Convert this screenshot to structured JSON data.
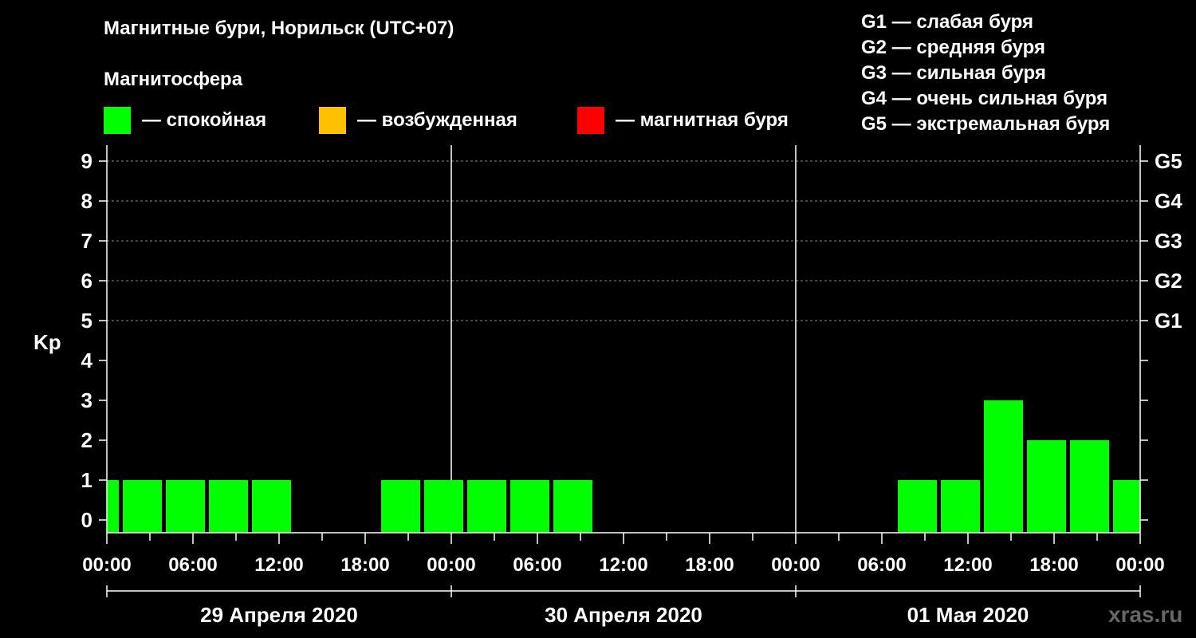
{
  "title": "Магнитные бури, Норильск (UTC+07)",
  "magnetosphere_label": "Магнитосфера",
  "legend": [
    {
      "label": "— спокойная",
      "color": "#00ff00"
    },
    {
      "label": "— возбужденная",
      "color": "#ffc000"
    },
    {
      "label": "— магнитная буря",
      "color": "#ff0000"
    }
  ],
  "g_legend": [
    "G1 — слабая буря",
    "G2 — средняя буря",
    "G3 — сильная буря",
    "G4 — очень сильная буря",
    "G5 — экстремальная буря"
  ],
  "brand": "xras.ru",
  "chart_data": {
    "type": "bar",
    "ylabel": "Kp",
    "ylim": [
      0,
      9
    ],
    "y_ticks": [
      "0",
      "1",
      "2",
      "3",
      "4",
      "5",
      "6",
      "7",
      "8",
      "9"
    ],
    "right_ticks": [
      {
        "kp": 5,
        "label": "G1"
      },
      {
        "kp": 6,
        "label": "G2"
      },
      {
        "kp": 7,
        "label": "G3"
      },
      {
        "kp": 8,
        "label": "G4"
      },
      {
        "kp": 9,
        "label": "G5"
      }
    ],
    "x_tick_labels": [
      "00:00",
      "06:00",
      "12:00",
      "18:00",
      "00:00",
      "06:00",
      "12:00",
      "18:00",
      "00:00",
      "06:00",
      "12:00",
      "18:00",
      "00:00"
    ],
    "days": [
      "29 Апреля 2020",
      "30 Апреля 2020",
      "01 Мая 2020"
    ],
    "grid": "dashed at Kp 5-9",
    "bars": [
      {
        "start": "29 Апреля 2020 00:00",
        "end": "29 Апреля 2020 01:00",
        "kp": 1,
        "status": "спокойная"
      },
      {
        "start": "29 Апреля 2020 01:00",
        "end": "29 Апреля 2020 04:00",
        "kp": 1,
        "status": "спокойная"
      },
      {
        "start": "29 Апреля 2020 04:00",
        "end": "29 Апреля 2020 07:00",
        "kp": 1,
        "status": "спокойная"
      },
      {
        "start": "29 Апреля 2020 07:00",
        "end": "29 Апреля 2020 10:00",
        "kp": 1,
        "status": "спокойная"
      },
      {
        "start": "29 Апреля 2020 10:00",
        "end": "29 Апреля 2020 13:00",
        "kp": 1,
        "status": "спокойная"
      },
      {
        "start": "29 Апреля 2020 19:00",
        "end": "29 Апреля 2020 22:00",
        "kp": 1,
        "status": "спокойная"
      },
      {
        "start": "29 Апреля 2020 22:00",
        "end": "30 Апреля 2020 01:00",
        "kp": 1,
        "status": "спокойная"
      },
      {
        "start": "30 Апреля 2020 01:00",
        "end": "30 Апреля 2020 04:00",
        "kp": 1,
        "status": "спокойная"
      },
      {
        "start": "30 Апреля 2020 04:00",
        "end": "30 Апреля 2020 07:00",
        "kp": 1,
        "status": "спокойная"
      },
      {
        "start": "30 Апреля 2020 07:00",
        "end": "30 Апреля 2020 10:00",
        "kp": 1,
        "status": "спокойная"
      },
      {
        "start": "01 Мая 2020 07:00",
        "end": "01 Мая 2020 10:00",
        "kp": 1,
        "status": "спокойная"
      },
      {
        "start": "01 Мая 2020 10:00",
        "end": "01 Мая 2020 13:00",
        "kp": 1,
        "status": "спокойная"
      },
      {
        "start": "01 Мая 2020 13:00",
        "end": "01 Мая 2020 16:00",
        "kp": 3,
        "status": "спокойная"
      },
      {
        "start": "01 Мая 2020 16:00",
        "end": "01 Мая 2020 19:00",
        "kp": 2,
        "status": "спокойная"
      },
      {
        "start": "01 Мая 2020 19:00",
        "end": "01 Мая 2020 22:00",
        "kp": 2,
        "status": "спокойная"
      },
      {
        "start": "01 Мая 2020 22:00",
        "end": "02 Мая 2020 00:00",
        "kp": 1,
        "status": "спокойная"
      }
    ]
  }
}
